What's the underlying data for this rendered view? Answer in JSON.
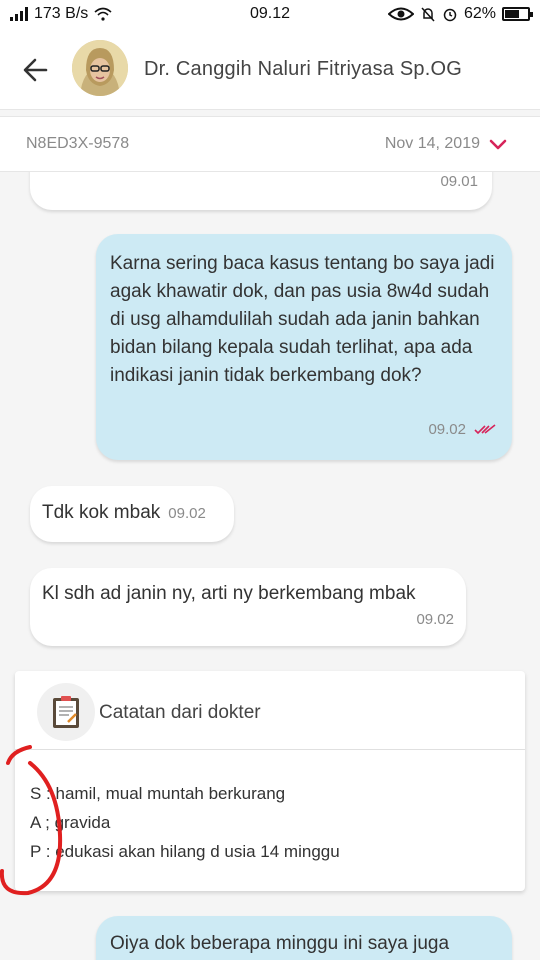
{
  "status_bar": {
    "network_speed": "173 B/s",
    "time": "09.12",
    "battery_percent": "62%",
    "battery_level": 0.62
  },
  "header": {
    "doctor_name": "Dr. Canggih Naluri Fitriyasa Sp.OG"
  },
  "consultation": {
    "id": "N8ED3X-9578",
    "date": "Nov 14, 2019"
  },
  "messages": [
    {
      "time": "09.01"
    },
    {
      "text": "Karna sering baca kasus tentang bo saya jadi agak khawatir dok, dan pas usia 8w4d sudah di usg alhamdulilah sudah ada janin bahkan bidan bilang kepala sudah terlihat, apa ada indikasi janin tidak berkembang dok?",
      "time": "09.02"
    },
    {
      "text": "Tdk kok mbak",
      "time": "09.02"
    },
    {
      "text": "Kl sdh ad janin ny, arti ny berkembang mbak",
      "time": "09.02"
    },
    {
      "text": "Oiya dok beberapa minggu ini saya juga"
    }
  ],
  "note": {
    "title": "Catatan dari dokter",
    "lines": [
      "S : hamil, mual muntah berkurang",
      "A ; gravida",
      "P : edukasi akan hilang d usia 14 minggu"
    ]
  },
  "colors": {
    "outgoing_bubble": "#cdeaf4",
    "incoming_bubble": "#ffffff",
    "accent": "#d6245a",
    "annotation_circle": "#e02020"
  }
}
